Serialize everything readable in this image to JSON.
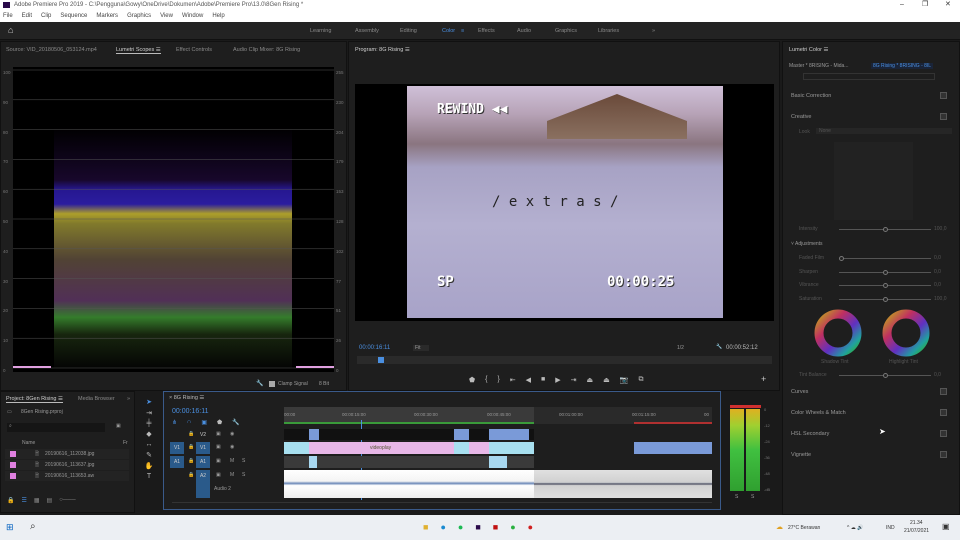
{
  "window": {
    "title": "Adobe Premiere Pro 2019 - C:\\Pengguna\\Gowy\\OneDrive\\Dokumen\\Adobe\\Premiere Pro\\13.0\\8Gen Rising *",
    "controls": [
      "–",
      "❐",
      "✕"
    ]
  },
  "menu": [
    "File",
    "Edit",
    "Clip",
    "Sequence",
    "Markers",
    "Graphics",
    "View",
    "Window",
    "Help"
  ],
  "workspaces": {
    "items": [
      "Learning",
      "Assembly",
      "Editing",
      "Color",
      "Effects",
      "Audio",
      "Graphics",
      "Libraries"
    ],
    "active": "Color",
    "more": "»"
  },
  "scopes_panel": {
    "tabs": [
      "Source: VID_20180506_053124.mp4",
      "Lumetri Scopes ☰",
      "Effect Controls",
      "Audio Clip Mixer: 8G Rising"
    ],
    "left_axis": [
      "100",
      "90",
      "80",
      "70",
      "60",
      "50",
      "40",
      "30",
      "20",
      "10",
      "0"
    ],
    "right_axis": [
      "255",
      "230",
      "204",
      "179",
      "153",
      "128",
      "102",
      "77",
      "51",
      "26",
      "0"
    ],
    "clamp_signal": "Clamp Signal",
    "bit_depth": "8 Bit"
  },
  "program": {
    "title": "Program: 8G Rising ☰",
    "timecode": "00:00:16:11",
    "fit": "Fit",
    "resolution": "1/2",
    "duration": "00:00:52:12",
    "video_text": {
      "rewind": "REWIND ◀◀",
      "caption": "/ e x t r a s /",
      "mode": "SP",
      "counter": "00:00:25"
    },
    "playhead_fraction": 0.05
  },
  "lumetri": {
    "title": "Lumetri Color ☰",
    "master": "Master * 8RISING - Mida...",
    "clip": "8G Rising * 8RISING - 8IL",
    "sections": [
      "Basic Correction",
      "Creative",
      "Curves",
      "Color Wheels & Match",
      "HSL Secondary",
      "Vignette"
    ],
    "look_label": "Look",
    "look_value": "None",
    "intensity": {
      "label": "Intensity",
      "value": "100,0"
    },
    "adjustments": "Adjustments",
    "sliders": [
      {
        "label": "Faded Film",
        "value": "0,0",
        "fraction": 0
      },
      {
        "label": "Sharpen",
        "value": "0,0",
        "fraction": 0.5
      },
      {
        "label": "Vibrance",
        "value": "0,0",
        "fraction": 0.5
      },
      {
        "label": "Saturation",
        "value": "100,0",
        "fraction": 0.5
      }
    ],
    "wheels": [
      "Shadow Tint",
      "Highlight Tint"
    ],
    "tint_balance": {
      "label": "Tint Balance",
      "value": "0,0"
    }
  },
  "project": {
    "tabs": [
      "Project: 8Gen Rising ☰",
      "Media Browser",
      "»"
    ],
    "file": "8Gen Rising.prproj",
    "column": "Name",
    "column2": "Fr",
    "items": [
      "20190616_112038.jpg",
      "20190616_113637.jpg",
      "20190616_113653.aw"
    ]
  },
  "timeline": {
    "title": "8G Rising ☰",
    "timecode": "00:00:16:11",
    "ruler": [
      "00:00",
      "00:00:15:00",
      "00:00:30:00",
      "00:00:45:00",
      "00:01:00:00",
      "00:01:15:00",
      "00"
    ],
    "tracks": [
      {
        "name": "V2"
      },
      {
        "src": "V1",
        "name": "V1"
      },
      {
        "src": "A1",
        "name": "A1"
      },
      {
        "name": "A2",
        "label": "Audio 2"
      }
    ],
    "clip_label": "videoplay"
  },
  "meters": {
    "scale": [
      "0",
      "-12",
      "-24",
      "-36",
      "-48",
      "-dB"
    ],
    "solo": [
      "S",
      "S"
    ]
  },
  "taskbar": {
    "weather": "27°C Berawan",
    "lang": "IND",
    "time": "21.34",
    "date": "21/07/2021"
  }
}
